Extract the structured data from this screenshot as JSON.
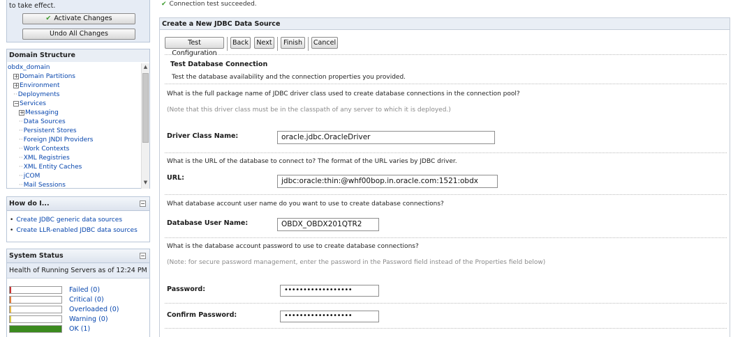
{
  "change_center": {
    "message": "to take effect.",
    "activate_label": "Activate Changes",
    "undo_label": "Undo All Changes"
  },
  "domain_structure": {
    "title": "Domain Structure",
    "tree": [
      {
        "label": "obdx_domain",
        "indent": 0,
        "expander": ""
      },
      {
        "label": "Domain Partitions",
        "indent": 1,
        "expander": "+"
      },
      {
        "label": "Environment",
        "indent": 1,
        "expander": "+"
      },
      {
        "label": "Deployments",
        "indent": 1,
        "expander": "-"
      },
      {
        "label": "Services",
        "indent": 1,
        "expander": "−"
      },
      {
        "label": "Messaging",
        "indent": 2,
        "expander": "+"
      },
      {
        "label": "Data Sources",
        "indent": 2,
        "expander": "-"
      },
      {
        "label": "Persistent Stores",
        "indent": 2,
        "expander": "-"
      },
      {
        "label": "Foreign JNDI Providers",
        "indent": 2,
        "expander": "-"
      },
      {
        "label": "Work Contexts",
        "indent": 2,
        "expander": "-"
      },
      {
        "label": "XML Registries",
        "indent": 2,
        "expander": "-"
      },
      {
        "label": "XML Entity Caches",
        "indent": 2,
        "expander": "-"
      },
      {
        "label": "jCOM",
        "indent": 2,
        "expander": "-"
      },
      {
        "label": "Mail Sessions",
        "indent": 2,
        "expander": "-"
      }
    ]
  },
  "how_do_i": {
    "title": "How do I...",
    "links": [
      "Create JDBC generic data sources",
      "Create LLR-enabled JDBC data sources"
    ]
  },
  "system_status": {
    "title": "System Status",
    "subtitle": "Health of Running Servers as of  12:24 PM",
    "rows": [
      {
        "label": "Failed (0)",
        "color": "#c83232",
        "fraction": 0
      },
      {
        "label": "Critical (0)",
        "color": "#e07a3c",
        "fraction": 0
      },
      {
        "label": "Overloaded (0)",
        "color": "#e6b84a",
        "fraction": 0
      },
      {
        "label": "Warning (0)",
        "color": "#d9c94a",
        "fraction": 0
      },
      {
        "label": "OK (1)",
        "color": "#3b8a1e",
        "fraction": 1
      }
    ]
  },
  "content": {
    "success_message": "Connection test succeeded.",
    "form_title": "Create a New JDBC Data Source",
    "buttons": {
      "test_configuration": "Test Configuration",
      "back": "Back",
      "next": "Next",
      "finish": "Finish",
      "cancel": "Cancel"
    },
    "step_title": "Test Database Connection",
    "step_description": "Test the database availability and the connection properties you provided.",
    "driver_question": "What is the full package name of JDBC driver class used to create database connections in the connection pool?",
    "driver_note": "(Note that this driver class must be in the classpath of any server to which it is deployed.)",
    "driver_label": "Driver Class Name:",
    "driver_value": "oracle.jdbc.OracleDriver",
    "url_question": "What is the URL of the database to connect to? The format of the URL varies by JDBC driver.",
    "url_label": "URL:",
    "url_value": "jdbc:oracle:thin:@whf00bop.in.oracle.com:1521:obdx",
    "user_question": "What database account user name do you want to use to create database connections?",
    "user_label": "Database User Name:",
    "user_value": "OBDX_OBDX201QTR2",
    "password_question": "What is the database account password to use to create database connections?",
    "password_note": "(Note: for secure password management, enter the password in the Password field instead of the Properties field below)",
    "password_label": "Password:",
    "password_value": "••••••••••••••••••",
    "confirm_label": "Confirm Password:",
    "confirm_value": "••••••••••••••••••"
  }
}
